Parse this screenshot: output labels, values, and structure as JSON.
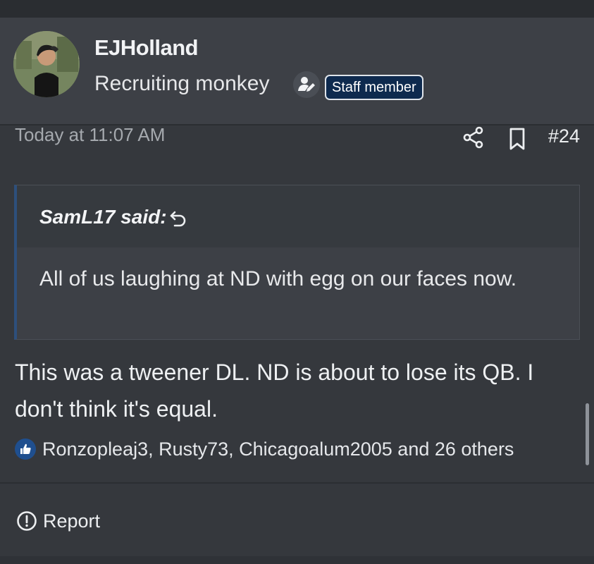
{
  "author": {
    "username": "EJHolland",
    "user_title": "Recruiting monkey",
    "staff_badge": "Staff member"
  },
  "post": {
    "date": "Today at 11:07 AM",
    "number": "#24",
    "quote": {
      "author": "SamL17 said:",
      "text": "All of us laughing at ND with egg on our faces now."
    },
    "body": "This was a tweener DL. ND is about to lose its QB. I don't think it's equal.",
    "reactions": "Ronzopleaj3, Rusty73, Chicagoalum2005 and 26 others",
    "report_label": "Report"
  },
  "icons": {
    "share": "share-icon",
    "bookmark": "bookmark-icon",
    "reply": "reply-icon",
    "like": "like-icon",
    "report": "report-icon",
    "staff": "staff-icon"
  },
  "colors": {
    "accent": "#2d4f7c",
    "staff_badge_bg": "#0e2a4e",
    "background": "#35383d"
  }
}
